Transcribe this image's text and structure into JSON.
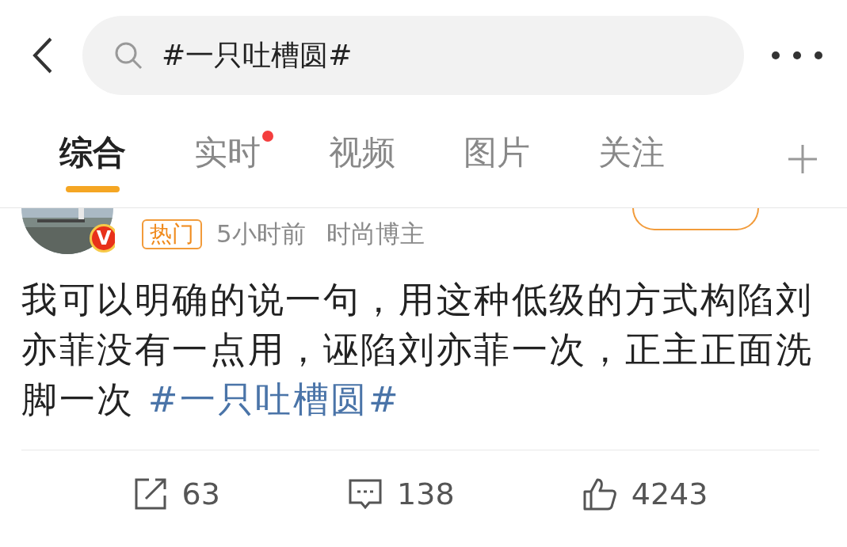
{
  "search": {
    "value": "#一只吐槽圆#"
  },
  "tabs": [
    {
      "label": "综合",
      "selected": true,
      "badge": false
    },
    {
      "label": "实时",
      "selected": false,
      "badge": true
    },
    {
      "label": "视频",
      "selected": false,
      "badge": false
    },
    {
      "label": "图片",
      "selected": false,
      "badge": false
    },
    {
      "label": "关注",
      "selected": false,
      "badge": false
    }
  ],
  "post": {
    "avatar": {
      "kind": "picture",
      "verified_badge": "V"
    },
    "tag": "热门",
    "time": "5小时前",
    "source": "时尚博主",
    "text": "我可以明确的说一句，用这种低级的方式构陷刘亦菲没有一点用，诬陷刘亦菲一次，正主正面洗脚一次",
    "hashtag": "#一只吐槽圆#",
    "actions": [
      {
        "kind": "repost",
        "count": "63"
      },
      {
        "kind": "comment",
        "count": "138"
      },
      {
        "kind": "like",
        "count": "4243"
      }
    ]
  }
}
